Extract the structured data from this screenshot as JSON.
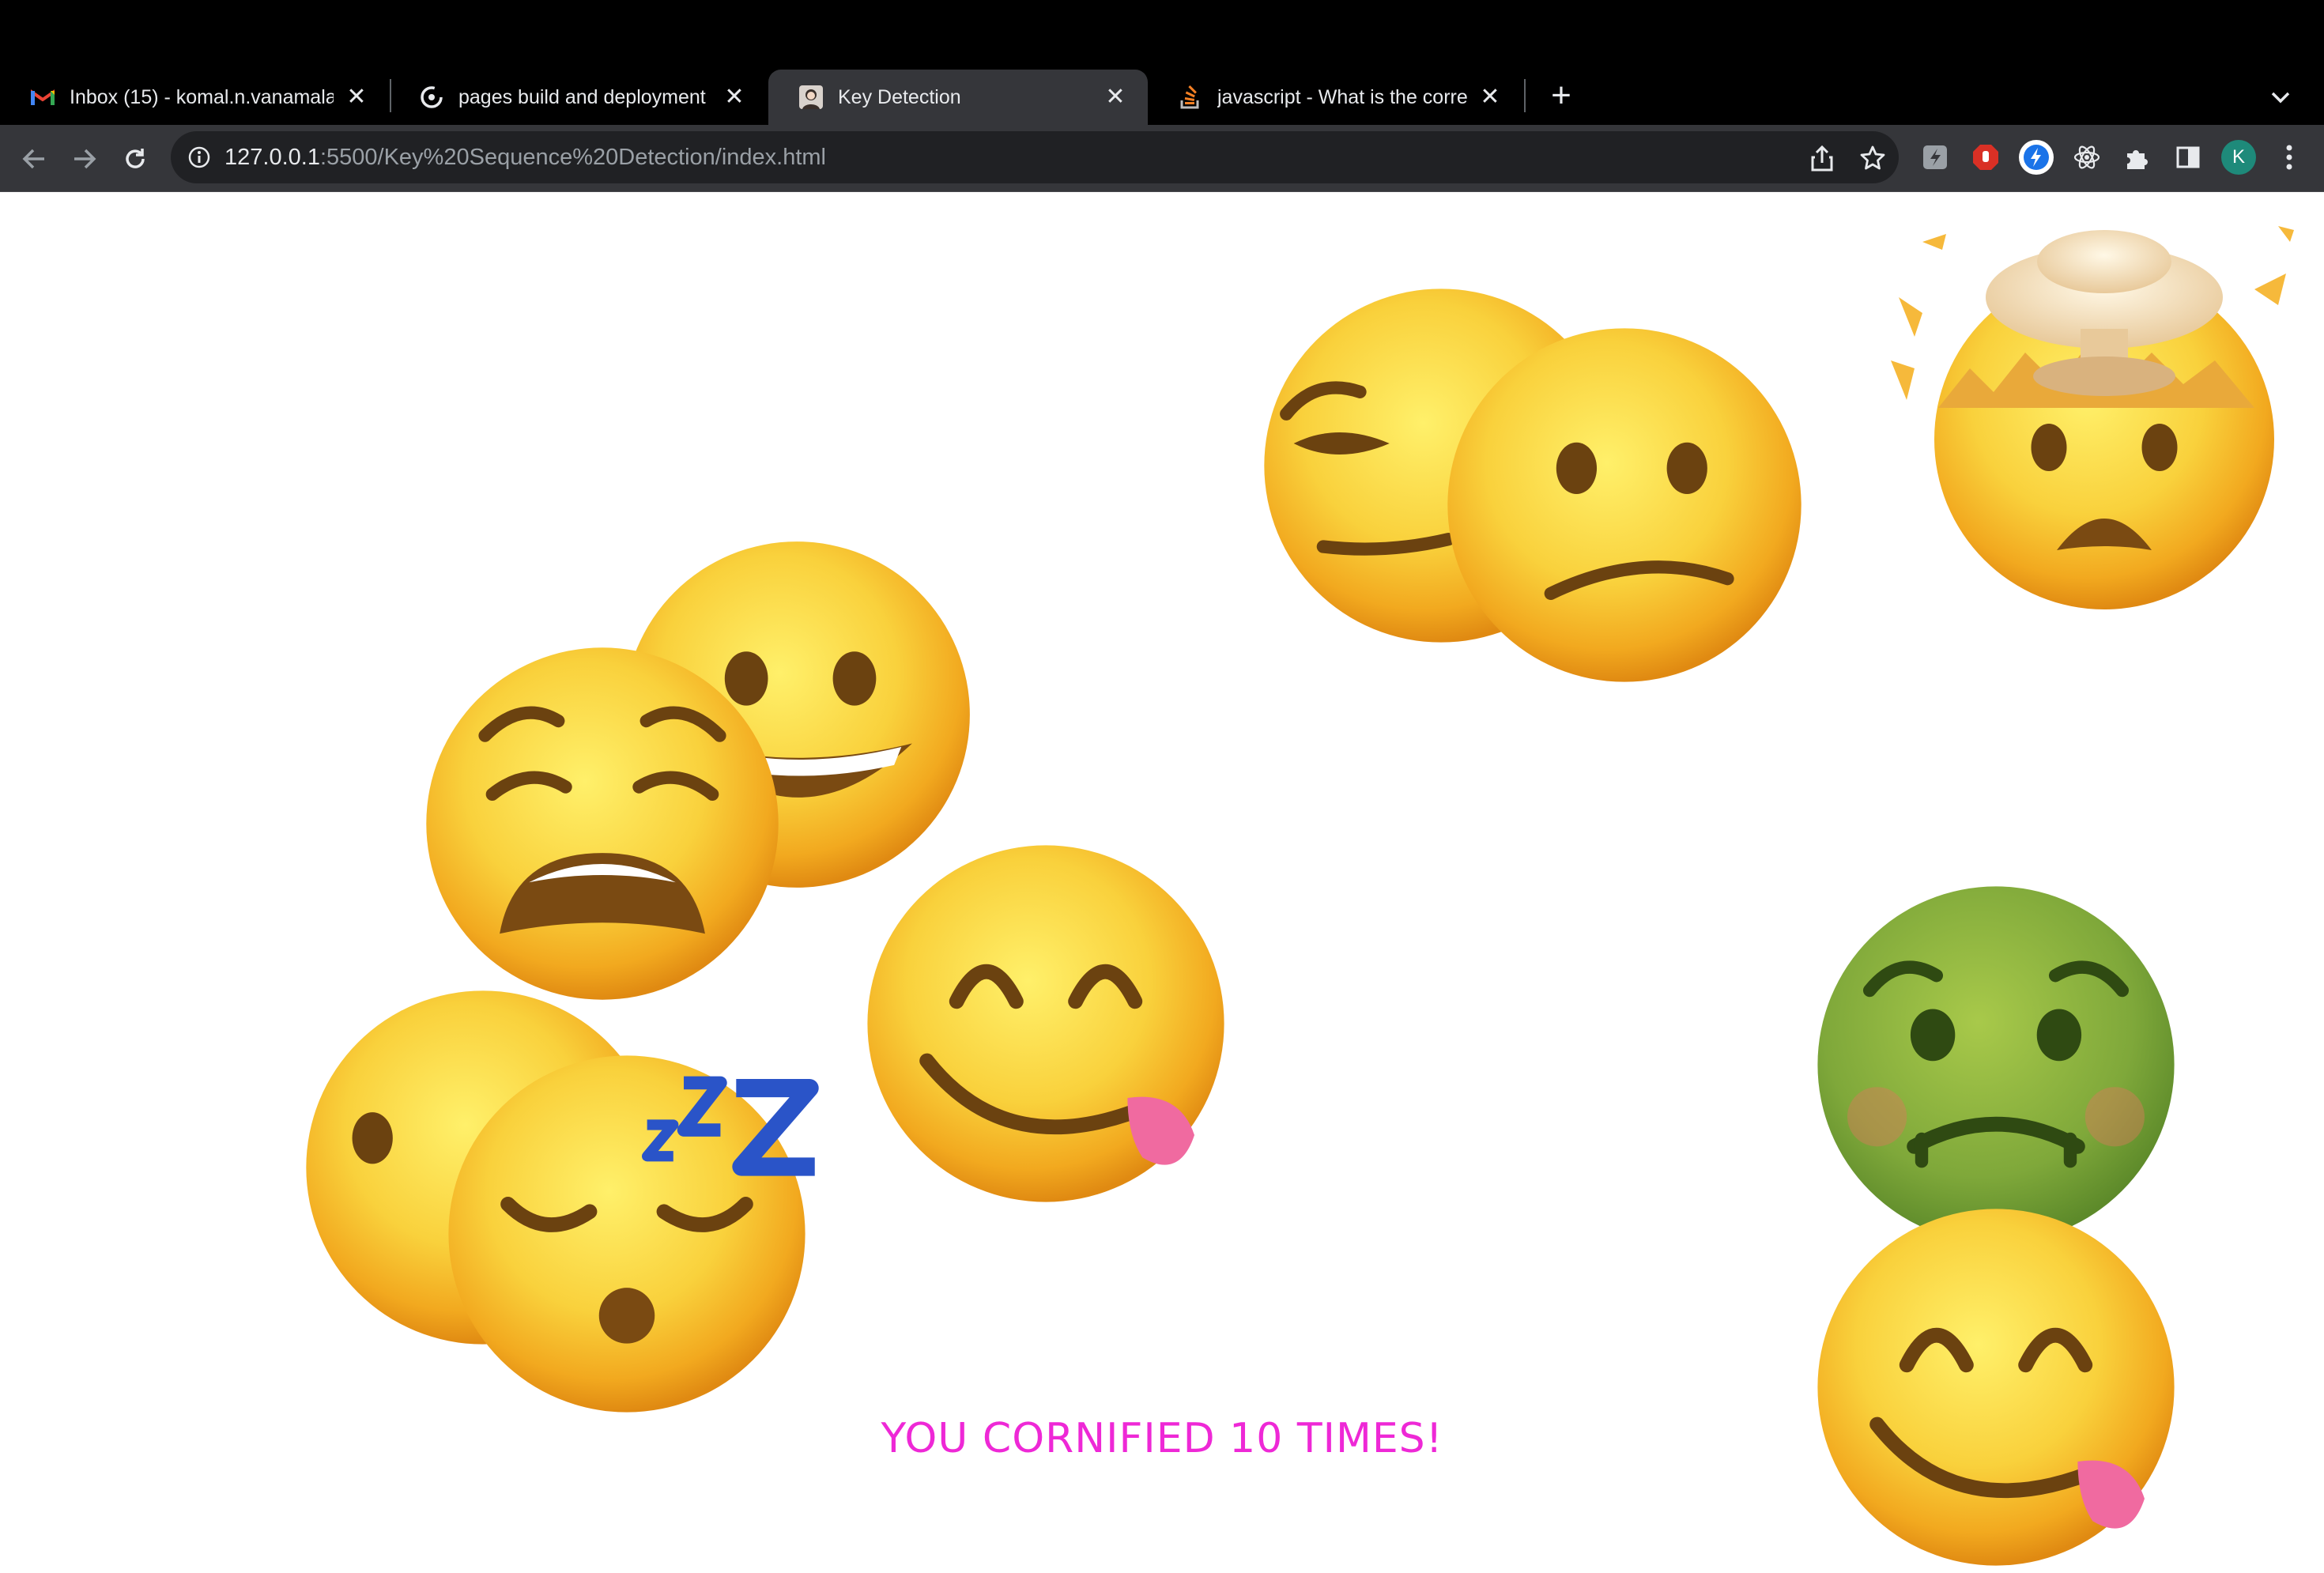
{
  "browser": {
    "tabs": [
      {
        "title": "Inbox (15) - komal.n.vanamala",
        "favicon": "gmail-icon",
        "active": false
      },
      {
        "title": "pages build and deployment ·",
        "favicon": "github-icon",
        "active": false
      },
      {
        "title": "Key Detection",
        "favicon": "page-avatar-icon",
        "active": true
      },
      {
        "title": "javascript - What is the correc",
        "favicon": "stackoverflow-icon",
        "active": false
      }
    ],
    "close_glyph": "✕",
    "new_tab_glyph": "+",
    "address": {
      "host": "127.0.0.1",
      "path": ":5500/Key%20Sequence%20Detection/index.html"
    },
    "profile_initial": "K"
  },
  "page": {
    "message": "YOU CORNIFIED 10 TIMES!",
    "emojis": [
      "grinning-face",
      "weary-face",
      "smirking-face",
      "confused-face",
      "exploding-head",
      "neutral-face",
      "sleeping-face",
      "yum-face",
      "nauseated-face",
      "yum-face"
    ]
  },
  "colors": {
    "chrome_bg": "#000000",
    "toolbar_bg": "#35363a",
    "omnibox_bg": "#202124",
    "message_color": "#ee28d6",
    "emoji_yellow": "#f7c33a",
    "emoji_green": "#7fa83a"
  }
}
